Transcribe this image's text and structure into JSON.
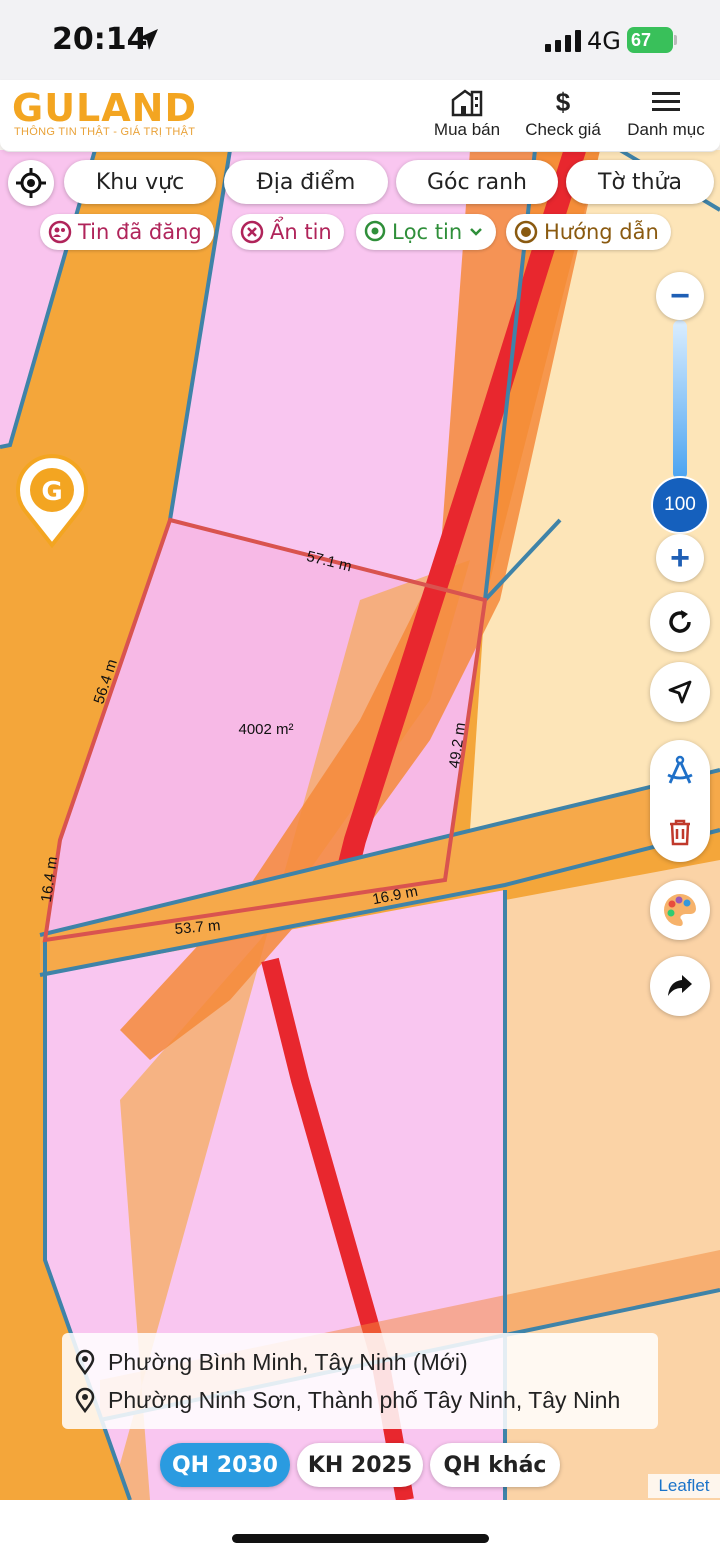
{
  "status_bar": {
    "time": "20:14",
    "network": "4G",
    "battery": "67"
  },
  "header": {
    "logo": "GULAND",
    "tagline": "THÔNG TIN THẬT - GIÁ TRỊ THẬT",
    "nav": [
      {
        "label": "Mua bán",
        "icon": "building-icon"
      },
      {
        "label": "Check giá",
        "icon": "dollar-icon"
      },
      {
        "label": "Danh mục",
        "icon": "menu-icon"
      }
    ]
  },
  "filters": [
    "Khu vực",
    "Địa điểm",
    "Góc ranh",
    "Tờ thửa"
  ],
  "chips": [
    {
      "label": "Tin đã đăng",
      "color": "#b0245a"
    },
    {
      "label": "Ẩn tin",
      "color": "#b0245a"
    },
    {
      "label": "Lọc tin",
      "color": "#2f8f3a"
    },
    {
      "label": "Hướng dẫn",
      "color": "#8a5a10"
    }
  ],
  "zoom": {
    "level": "100",
    "minus": "−",
    "plus": "+"
  },
  "parcel": {
    "area": "4002 m²",
    "edges": [
      "57.1 m",
      "56.4 m",
      "49.2 m",
      "16.4 m",
      "16.9 m",
      "53.7 m"
    ]
  },
  "address": {
    "line1": "Phường Bình Minh, Tây Ninh (Mới)",
    "line2": "Phường Ninh Sơn, Thành phố Tây Ninh, Tây Ninh"
  },
  "plan_tabs": [
    {
      "label": "QH 2030",
      "active": true
    },
    {
      "label": "KH 2025",
      "active": false
    },
    {
      "label": "QH khác",
      "active": false
    }
  ],
  "attribution": "Leaflet",
  "colors": {
    "accent": "#f3a521",
    "active_tab": "#2a9be0",
    "zoom": "#1560bd",
    "parcel_outline": "#d9534f"
  }
}
